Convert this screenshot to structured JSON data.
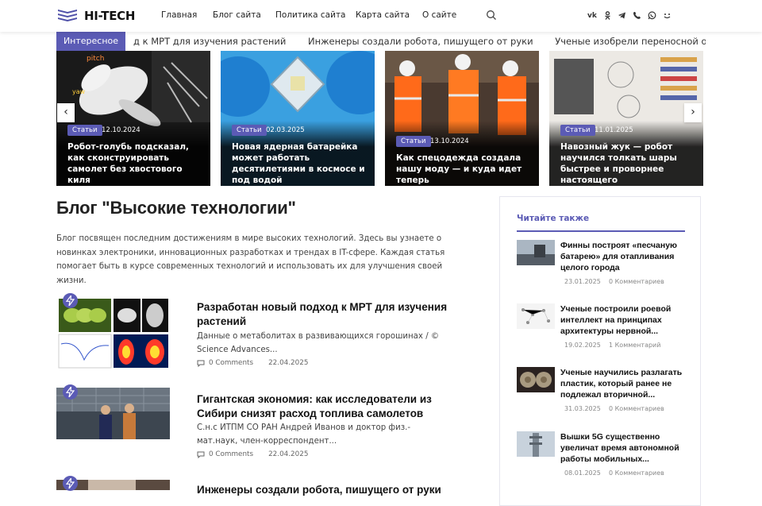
{
  "header": {
    "logo_text": "HI-TECH",
    "nav": [
      "Главная",
      "Блог сайта",
      "Политика сайта",
      "Карта сайта",
      "О сайте"
    ],
    "social_icons": [
      "vk-icon",
      "odnoklassniki-icon",
      "telegram-icon",
      "viber-icon",
      "whatsapp-icon",
      "yandex-zen-icon"
    ]
  },
  "ticker": {
    "label": "Интересное",
    "items": [
      "д к МРТ для изучения растений",
      "Инженеры создали робота, пишущего от руки",
      "Ученые изобрели переносной очиститель воды, котор"
    ]
  },
  "slider": [
    {
      "badge": "Статьи",
      "date": "12.10.2024",
      "title": "Робот-голубь подсказал, как сконструировать самолет без хвостового киля"
    },
    {
      "badge": "Статьи",
      "date": "02.03.2025",
      "title": "Новая ядерная батарейка может работать десятилетиями в космосе и под водой"
    },
    {
      "badge": "Статьи",
      "date": "13.10.2024",
      "title": "Как спецодежда создала нашу моду — и куда идет теперь"
    },
    {
      "badge": "Статьи",
      "date": "11.01.2025",
      "title": "Навозный жук — робот научился толкать шары быстрее и проворнее настоящего"
    }
  ],
  "slider_nav": {
    "prev": "‹",
    "next": "›"
  },
  "page": {
    "title": "Блог \"Высокие технологии\"",
    "intro": "Блог посвящен последним достижениям в мире высоких технологий. Здесь вы узнаете о новинках электроники, инновационных разработках и трендах в IT-сфере. Каждая статья помогает быть в курсе современных технологий и использовать их для улучшения своей жизни."
  },
  "posts": [
    {
      "title": "Разработан новый подход к МРТ для изучения растений",
      "excerpt": "Данные о метаболитах в развивающихся горошинах / © Science Advances...",
      "comments": "0 Comments",
      "date": "22.04.2025"
    },
    {
      "title": "Гигантская экономия: как исследователи из Сибири снизят расход топлива самолетов",
      "excerpt": "С.н.с ИТПМ СО РАН Андрей Иванов и доктор физ.-мат.наук, член-корреспондент...",
      "comments": "0 Comments",
      "date": "22.04.2025"
    },
    {
      "title": "Инженеры создали робота, пишущего от руки",
      "excerpt": "",
      "comments": "",
      "date": ""
    }
  ],
  "sidebar": {
    "heading": "Читайте также",
    "items": [
      {
        "title": "Финны построят «песчаную батарею» для отапливания целого города",
        "date": "23.01.2025",
        "comments": "0 Комментариев"
      },
      {
        "title": "Ученые построили роевой интеллект на принципах архитектуры нервной...",
        "date": "19.02.2025",
        "comments": "1 Комментарий"
      },
      {
        "title": "Ученые научились разлагать пластик, который ранее не подлежал вторичной...",
        "date": "31.03.2025",
        "comments": "0 Комментариев"
      },
      {
        "title": "Вышки 5G существенно увеличат время автономной работы мобильных...",
        "date": "08.01.2025",
        "comments": "0 Комментариев"
      }
    ]
  },
  "colors": {
    "accent": "#5b5bb5",
    "logo": "#4e4fa8"
  }
}
